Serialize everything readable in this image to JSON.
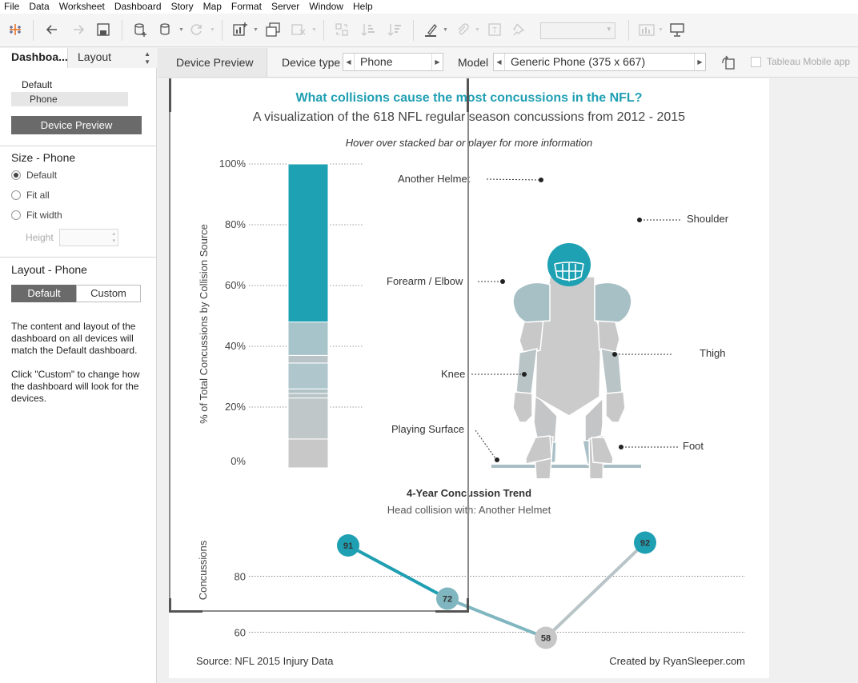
{
  "menu": [
    "File",
    "Data",
    "Worksheet",
    "Dashboard",
    "Story",
    "Map",
    "Format",
    "Server",
    "Window",
    "Help"
  ],
  "toolbar": {
    "icons": [
      "tableau-logo-icon",
      "undo-icon",
      "redo-icon",
      "save-icon",
      "new-data-source-icon",
      "pause-updates-icon",
      "refresh-icon",
      "new-worksheet-icon",
      "duplicate-icon",
      "clear-icon",
      "swap-icon",
      "sort-ascending-icon",
      "sort-descending-icon",
      "highlight-icon",
      "group-icon",
      "label-icon",
      "pin-icon",
      "show-me-icon",
      "presentation-icon"
    ]
  },
  "left_pane": {
    "tab_dashboard": "Dashboa...",
    "tab_layout": "Layout",
    "device_default": "Default",
    "device_phone": "Phone",
    "device_preview_button": "Device Preview",
    "size_heading": "Size - Phone",
    "size_options": [
      "Default",
      "Fit all",
      "Fit width"
    ],
    "size_selected": "Default",
    "height_label": "Height",
    "layout_heading": "Layout - Phone",
    "layout_default": "Default",
    "layout_custom": "Custom",
    "desc1": "The content and layout of the dashboard on all devices will match the Default dashboard.",
    "desc2": "Click \"Custom\" to change how the dashboard will look for the devices."
  },
  "device_bar": {
    "tab": "Device Preview",
    "device_type_label": "Device type",
    "device_type_value": "Phone",
    "model_label": "Model",
    "model_value": "Generic Phone (375 x 667)",
    "mobile_app_label": "Tableau Mobile app"
  },
  "dashboard": {
    "title": "What collisions cause the most concussions in the NFL?",
    "subtitle": "A visualization of the 618 NFL regular season concussions from 2012 - 2015",
    "hover_note": "Hover over stacked bar or player for more information",
    "callouts": {
      "another_helmet": "Another Helmet",
      "shoulder": "Shoulder",
      "forearm_elbow": "Forearm / Elbow",
      "thigh": "Thigh",
      "knee": "Knee",
      "playing_surface": "Playing Surface",
      "foot": "Foot"
    },
    "trend_title": "4-Year Concussion Trend",
    "trend_subtitle": "Head collision with: Another Helmet",
    "source": "Source: NFL 2015 Injury Data",
    "credit": "Created by RyanSleeper.com"
  },
  "chart_data": [
    {
      "type": "bar",
      "stacked": true,
      "ylabel": "% of Total Concussions by Collision Source",
      "ylim": [
        0,
        100
      ],
      "yticks": [
        "0%",
        "20%",
        "40%",
        "60%",
        "80%",
        "100%"
      ],
      "segments_bottom_to_top": [
        {
          "value": 9.5,
          "color": "#c8c8c8"
        },
        {
          "value": 13.5,
          "color": "#c0c7c9"
        },
        {
          "value": 1.5,
          "color": "#b8c4c7"
        },
        {
          "value": 1.5,
          "color": "#b2c3c7"
        },
        {
          "value": 8.5,
          "color": "#afc6cc"
        },
        {
          "value": 2.5,
          "color": "#b8c4c7"
        },
        {
          "value": 11,
          "color": "#a7c4cb"
        },
        {
          "value": 52,
          "color": "#1fa1b4"
        }
      ]
    },
    {
      "type": "line",
      "title": "4-Year Concussion Trend",
      "ylabel": "Concussions",
      "yticks": [
        60,
        80
      ],
      "ylim": [
        55,
        95
      ],
      "values": [
        91,
        72,
        58,
        92
      ],
      "point_colors": [
        "#1f9fb2",
        "#7fb6c0",
        "#c7c7c7",
        "#1f9fb2"
      ]
    }
  ]
}
